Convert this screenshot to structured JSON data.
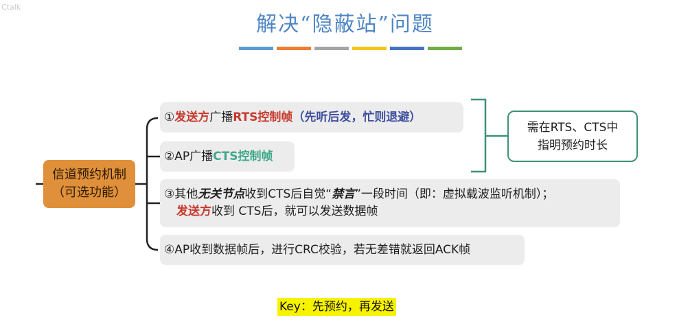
{
  "watermark": "Ctalk",
  "title": "解决“隐蔽站”问题",
  "color_bars": [
    "#5b9bd5",
    "#ed7d31",
    "#a5a5a5",
    "#f5c518",
    "#4472c4",
    "#70ad47"
  ],
  "root": {
    "line1": "信道预约机制",
    "line2": "（可选功能）"
  },
  "item1": {
    "num": "①",
    "sender": "发送方",
    "mid": "广播",
    "frame": "RTS控制帧",
    "paren": "（先听后发，忙则退避）"
  },
  "item2": {
    "num": "②",
    "prefix": "AP广播",
    "frame": "CTS控制帧"
  },
  "item3": {
    "num": "③",
    "prefix": "其他",
    "stations": "无关节点",
    "mid": "收到CTS后自觉“",
    "silence": "禁言",
    "rest": "”一段时间（即：虚拟载波监听机制）；",
    "sender": "发送方",
    "line2": "收到 CTS后，就可以发送数据帧"
  },
  "item4": {
    "text": "④AP收到数据帧后，进行CRC校验，若无差错就返回ACK帧"
  },
  "note": {
    "line1": "需在RTS、CTS中",
    "line2": "指明预约时长"
  },
  "key": "Key：先预约，再发送",
  "colors": {
    "title": "#4e86c4",
    "root": "#e0903a",
    "accent_red": "#c73a2e",
    "accent_teal": "#3fa88a",
    "note_border": "#3f8f78",
    "key_bg": "#f7f200"
  }
}
